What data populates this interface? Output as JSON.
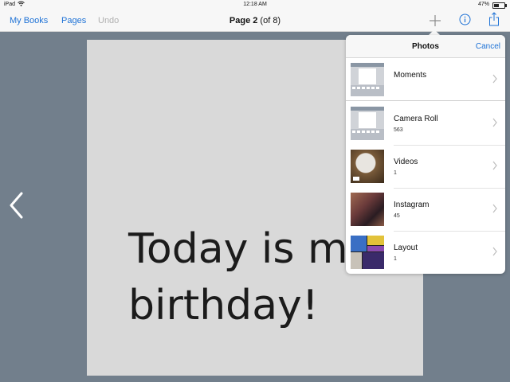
{
  "status": {
    "carrier": "iPad",
    "time": "12:18 AM",
    "battery": "47%",
    "battery_level": 0.47
  },
  "nav": {
    "my_books": "My Books",
    "pages": "Pages",
    "undo": "Undo",
    "title_page": "Page 2",
    "title_total": "(of 8)"
  },
  "page": {
    "text": "Today is my\nbirthday!"
  },
  "popover": {
    "title": "Photos",
    "cancel": "Cancel",
    "albums": [
      {
        "name": "Moments",
        "count": ""
      },
      {
        "name": "Camera Roll",
        "count": "563"
      },
      {
        "name": "Videos",
        "count": "1"
      },
      {
        "name": "Instagram",
        "count": "45"
      },
      {
        "name": "Layout",
        "count": "1"
      }
    ]
  },
  "colors": {
    "accent": "#1e72d6",
    "background": "#727f8c",
    "page": "#d9d9d9"
  },
  "icons": [
    "wifi-icon",
    "battery-icon",
    "plus-icon",
    "info-icon",
    "share-icon",
    "chevron-left-icon",
    "chevron-right-icon"
  ]
}
